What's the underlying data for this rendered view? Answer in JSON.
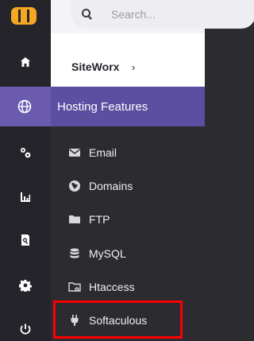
{
  "search": {
    "placeholder": "Search..."
  },
  "breadcrumb": {
    "current": "SiteWorx",
    "chevron": "›"
  },
  "section": {
    "label": "Hosting Features"
  },
  "submenu": {
    "items": [
      {
        "label": "Email",
        "icon": "mail-icon"
      },
      {
        "label": "Domains",
        "icon": "globe-icon"
      },
      {
        "label": "FTP",
        "icon": "folder-icon"
      },
      {
        "label": "MySQL",
        "icon": "database-icon"
      },
      {
        "label": "Htaccess",
        "icon": "folder-settings-icon"
      },
      {
        "label": "Softaculous",
        "icon": "plug-icon"
      }
    ]
  },
  "colors": {
    "accent": "#5c4ea1",
    "logo": "#f5a623",
    "highlight": "#ff0000"
  }
}
